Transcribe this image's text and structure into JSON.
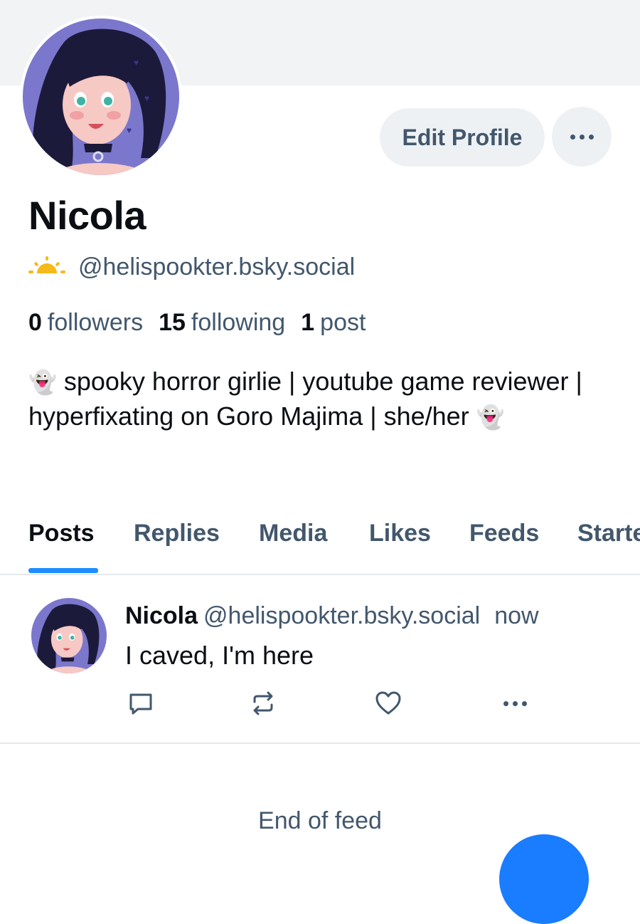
{
  "profile": {
    "name": "Nicola",
    "handle": "@helispookter.bsky.social",
    "handle_icon": "sun-emoji-icon",
    "stats": {
      "followers_count": "0",
      "followers_label": "followers",
      "following_count": "15",
      "following_label": "following",
      "posts_count": "1",
      "posts_label": "post"
    },
    "bio": {
      "lead_emoji": "👻",
      "text": "spooky horror girlie | youtube game reviewer | hyperfixating on Goro Majima | she/her",
      "trail_emoji": "👻"
    },
    "edit_label": "Edit Profile"
  },
  "tabs": [
    {
      "label": "Posts",
      "active": true
    },
    {
      "label": "Replies"
    },
    {
      "label": "Media"
    },
    {
      "label": "Likes"
    },
    {
      "label": "Feeds"
    },
    {
      "label": "Starter Packs"
    }
  ],
  "post": {
    "author": "Nicola",
    "handle": "@helispookter.bsky.social",
    "time": "now",
    "text": "I caved, I'm here"
  },
  "feed_end": "End of feed",
  "colors": {
    "accent": "#1d8cff",
    "muted_text": "#42576c",
    "banner": "#f1f3f5",
    "fab": "#1a7cff"
  }
}
